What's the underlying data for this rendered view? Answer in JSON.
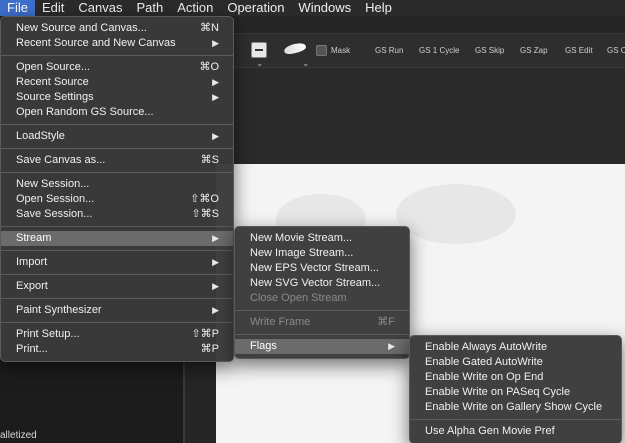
{
  "menubar": {
    "items": [
      "File",
      "Edit",
      "Canvas",
      "Path",
      "Action",
      "Operation",
      "Windows",
      "Help"
    ]
  },
  "toolbar": {
    "mask_label": "Mask",
    "buttons": [
      "GS Run",
      "GS 1 Cycle",
      "GS Skip",
      "GS Zap",
      "GS Edit",
      "GS C"
    ]
  },
  "status": {
    "text": "alletized"
  },
  "file_menu": {
    "groups": [
      [
        {
          "label": "New Source and Canvas...",
          "shortcut": "⌘N"
        },
        {
          "label": "Recent Source and New Canvas",
          "submenu": true
        }
      ],
      [
        {
          "label": "Open Source...",
          "shortcut": "⌘O"
        },
        {
          "label": "Recent Source",
          "submenu": true
        },
        {
          "label": "Source Settings",
          "submenu": true
        },
        {
          "label": "Open Random GS Source..."
        }
      ],
      [
        {
          "label": "LoadStyle",
          "submenu": true
        }
      ],
      [
        {
          "label": "Save Canvas as...",
          "shortcut": "⌘S"
        }
      ],
      [
        {
          "label": "New Session..."
        },
        {
          "label": "Open Session...",
          "shortcut": "⇧⌘O"
        },
        {
          "label": "Save Session...",
          "shortcut": "⇧⌘S"
        }
      ],
      [
        {
          "label": "Stream",
          "submenu": true,
          "highlighted": true
        }
      ],
      [
        {
          "label": "Import",
          "submenu": true
        }
      ],
      [
        {
          "label": "Export",
          "submenu": true
        }
      ],
      [
        {
          "label": "Paint Synthesizer",
          "submenu": true
        }
      ],
      [
        {
          "label": "Print Setup...",
          "shortcut": "⇧⌘P"
        },
        {
          "label": "Print...",
          "shortcut": "⌘P"
        }
      ]
    ]
  },
  "stream_menu": {
    "groups": [
      [
        {
          "label": "New Movie Stream..."
        },
        {
          "label": "New Image Stream..."
        },
        {
          "label": "New EPS Vector Stream..."
        },
        {
          "label": "New SVG Vector Stream..."
        },
        {
          "label": "Close Open Stream",
          "disabled": true
        }
      ],
      [
        {
          "label": "Write Frame",
          "shortcut": "⌘F",
          "disabled": true
        }
      ],
      [
        {
          "label": "Flags",
          "submenu": true,
          "highlighted": true
        }
      ]
    ]
  },
  "flags_menu": {
    "groups": [
      [
        {
          "label": "Enable Always AutoWrite"
        },
        {
          "label": "Enable Gated AutoWrite"
        },
        {
          "label": "Enable Write on Op End"
        },
        {
          "label": "Enable Write on PASeq Cycle"
        },
        {
          "label": "Enable Write on Gallery Show Cycle"
        }
      ],
      [
        {
          "label": "Use Alpha Gen Movie Pref"
        }
      ]
    ]
  },
  "colors": {
    "menubar_active": "#3d6fcc",
    "menu_bg": "#3a3a3a",
    "menu_highlight": "#6b6b6b",
    "disabled_text": "#8a8a8a",
    "canvas": "#f4f4f4"
  }
}
